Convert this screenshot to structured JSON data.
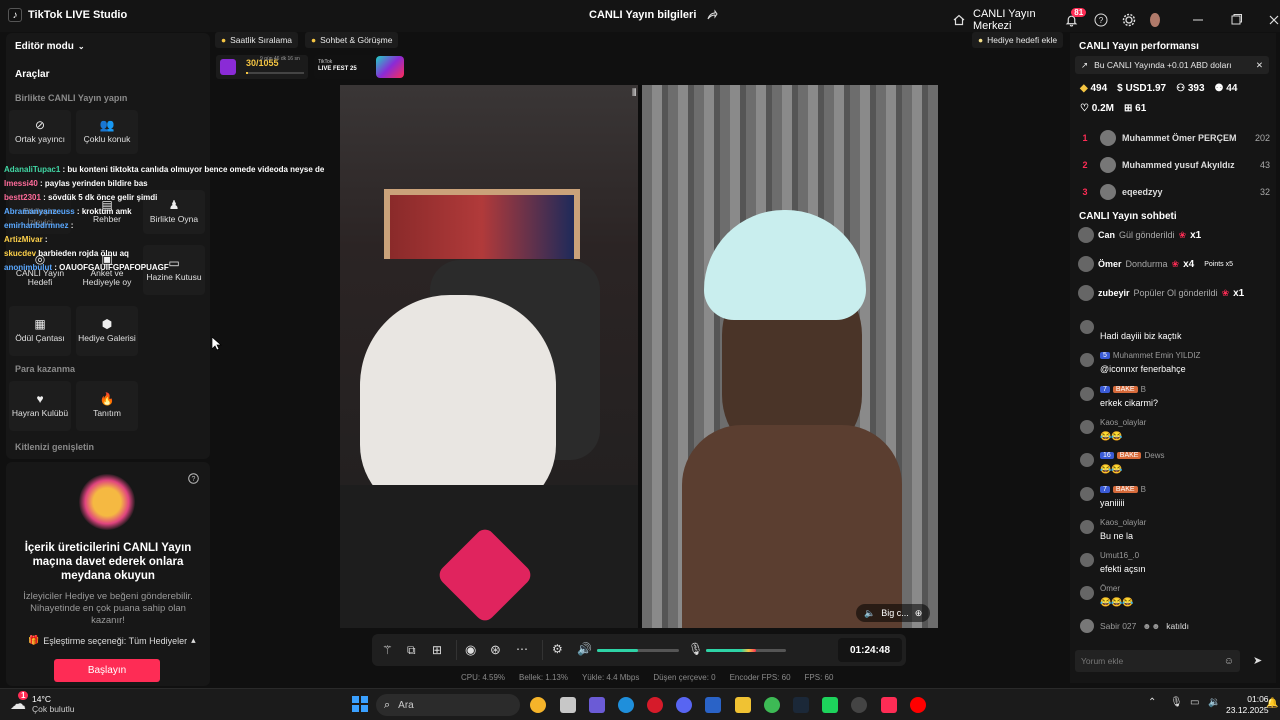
{
  "titlebar": {
    "app_name": "TikTok LIVE Studio",
    "center_title": "CANLI Yayın bilgileri",
    "center_share_icon": "share-icon",
    "live_center": "CANLI Yayın Merkezi",
    "notification_count": "81"
  },
  "left": {
    "editor_mode": "Editör modu",
    "tools_title": "Araçlar",
    "section_together": "Birlikte CANLI Yayın yapın",
    "tool_cohost": "Ortak yayıncı",
    "tool_multi": "Çoklu konuk",
    "tool_interaction": "Etkileşim",
    "tool_viewer": "İzleyici",
    "tool_guide": "Rehber",
    "tool_play": "Birlikte Oyna",
    "tool_goal": "CANLI Yayın Hedefi",
    "tool_poll": "Anket ve Hediyeyle oy",
    "tool_treasure": "Hazine Kutusu",
    "tool_reward": "Ödül Çantası",
    "tool_gallery": "Hediye Galerisi",
    "section_money": "Para kazanma",
    "tool_fanclub": "Hayran Kulübü",
    "tool_promo": "Tanıtım",
    "section_audience": "Kitlenizi genişletin"
  },
  "overlay_chat": [
    {
      "user": "AdanaliTupac1",
      "text": " : bu konteni tiktokta canlıda olmuyor bence omede videoda neyse de",
      "color": "#41d6a4"
    },
    {
      "user": "Imessi40",
      "text": " : paylas yerinden bildire bas",
      "color": "#ff6b9a"
    },
    {
      "user": "bestt2301",
      "text": " : sövdük 5 dk önce gelir şimdi",
      "color": "#ff6b9a"
    },
    {
      "user": "Abramanyanzeuss",
      "text": " : kroktum amk",
      "color": "#5aa8ff"
    },
    {
      "user": "emirhanbdrmnez",
      "text": " :",
      "color": "#5aa8ff"
    },
    {
      "user": "ArtizMivar",
      "text": " :",
      "color": "#ffd24a"
    },
    {
      "user": "skucdev",
      "text": " barbieden rojda ölnu aq",
      "color": "#ffd24a"
    },
    {
      "user": "anonimbulut",
      "text": " : OAUOFGAUIFGPAFOPUAGF",
      "color": "#5aa8ff"
    }
  ],
  "invite": {
    "title": "İçerik üreticilerini CANLI Yayın maçına davet ederek onlara meydana okuyun",
    "desc": "İzleyiciler Hediye ve beğeni gönderebilir. Nihayetinde en çok puana sahip olan kazanır!",
    "match_option": "Eşleştirme seçeneği: Tüm Hediyeler",
    "start_button": "Başlayın"
  },
  "top_chips": {
    "hourly_rank": "Saatlik Sıralama",
    "chat_meet": "Sohbet & Görüşme",
    "gift_goal": "Hediye hedefi ekle",
    "progress_text": "30/1055",
    "progress_fraction": 0.028,
    "timer_small": "9 gün 46 dk 16 sn",
    "fest_label": "LIVE FEST 25",
    "fest_brand": "TikTok"
  },
  "video": {
    "right_label": "Big c..."
  },
  "controls": {
    "timer": "01:24:48",
    "speaker_level": 0.5,
    "mic_level": 0.62
  },
  "stats": {
    "cpu": "CPU: 4.59%",
    "memory": "Bellek: 1.13%",
    "upload": "Yükle: 4.4 Mbps",
    "dropped": "Düşen çerçeve: 0",
    "encoder": "Encoder FPS: 60",
    "fps": "FPS: 60"
  },
  "right": {
    "perf_title": "CANLI Yayın performansı",
    "earning_banner": "Bu CANLI Yayında +0.01 ABD doları",
    "stat_diamond": "494",
    "stat_usd": "USD1.97",
    "stat_viewers": "393",
    "stat_new": "44",
    "stat_likes": "0.2M",
    "stat_gifts": "61",
    "ranking": [
      {
        "rank": "1",
        "name": "Muhammet Ömer PERÇEM",
        "score": "202"
      },
      {
        "rank": "2",
        "name": "Muhammed yusuf Akyıldız",
        "score": "43"
      },
      {
        "rank": "3",
        "name": "eqeedzyy",
        "score": "32"
      }
    ],
    "chat_title": "CANLI Yayın sohbeti",
    "gifts": [
      {
        "user": "Can",
        "text": "Gül gönderildi",
        "count": "x1"
      },
      {
        "user": "Ömer",
        "text": "Dondurma",
        "count": "x4",
        "extra": "Points x5"
      },
      {
        "user": "zubeyir",
        "text": "Popüler Ol gönderildi",
        "count": "x1"
      }
    ],
    "messages": [
      {
        "user": "",
        "level": "",
        "tag": "",
        "text": "Hadi dayiii biz kaçtık"
      },
      {
        "user": "Muhammet Emin YILDIZ",
        "level": "5",
        "tag": "",
        "text": "@iconnxr fenerbahçe"
      },
      {
        "user": "B",
        "level": "7",
        "tag": "BAKE",
        "text": "erkek cikarmi?"
      },
      {
        "user": "Kaos_olaylar",
        "level": "",
        "tag": "",
        "text": "😂😂"
      },
      {
        "user": "Dews",
        "level": "16",
        "tag": "BAKE",
        "text": "😂😂"
      },
      {
        "user": "B",
        "level": "7",
        "tag": "BAKE",
        "text": "yaniiiii"
      },
      {
        "user": "Kaos_olaylar",
        "level": "",
        "tag": "",
        "text": "Bu ne la"
      },
      {
        "user": "Umut16_.0",
        "level": "",
        "tag": "",
        "text": "efekti açsın"
      },
      {
        "user": "Ömer",
        "level": "",
        "tag": "",
        "text": "😂😂😂"
      }
    ],
    "joined_user": "Sabir 027",
    "joined_text": "katıldı",
    "comment_placeholder": "Yorum ekle"
  },
  "taskbar": {
    "weather_temp": "14°C",
    "weather_desc": "Çok bulutlu",
    "search_placeholder": "Ara",
    "time": "01:06",
    "date": "23.12.2025",
    "weather_badge": "1"
  },
  "colors": {
    "accent": "#fe2c55",
    "teal": "#2ed3a6",
    "bg": "#101010"
  }
}
